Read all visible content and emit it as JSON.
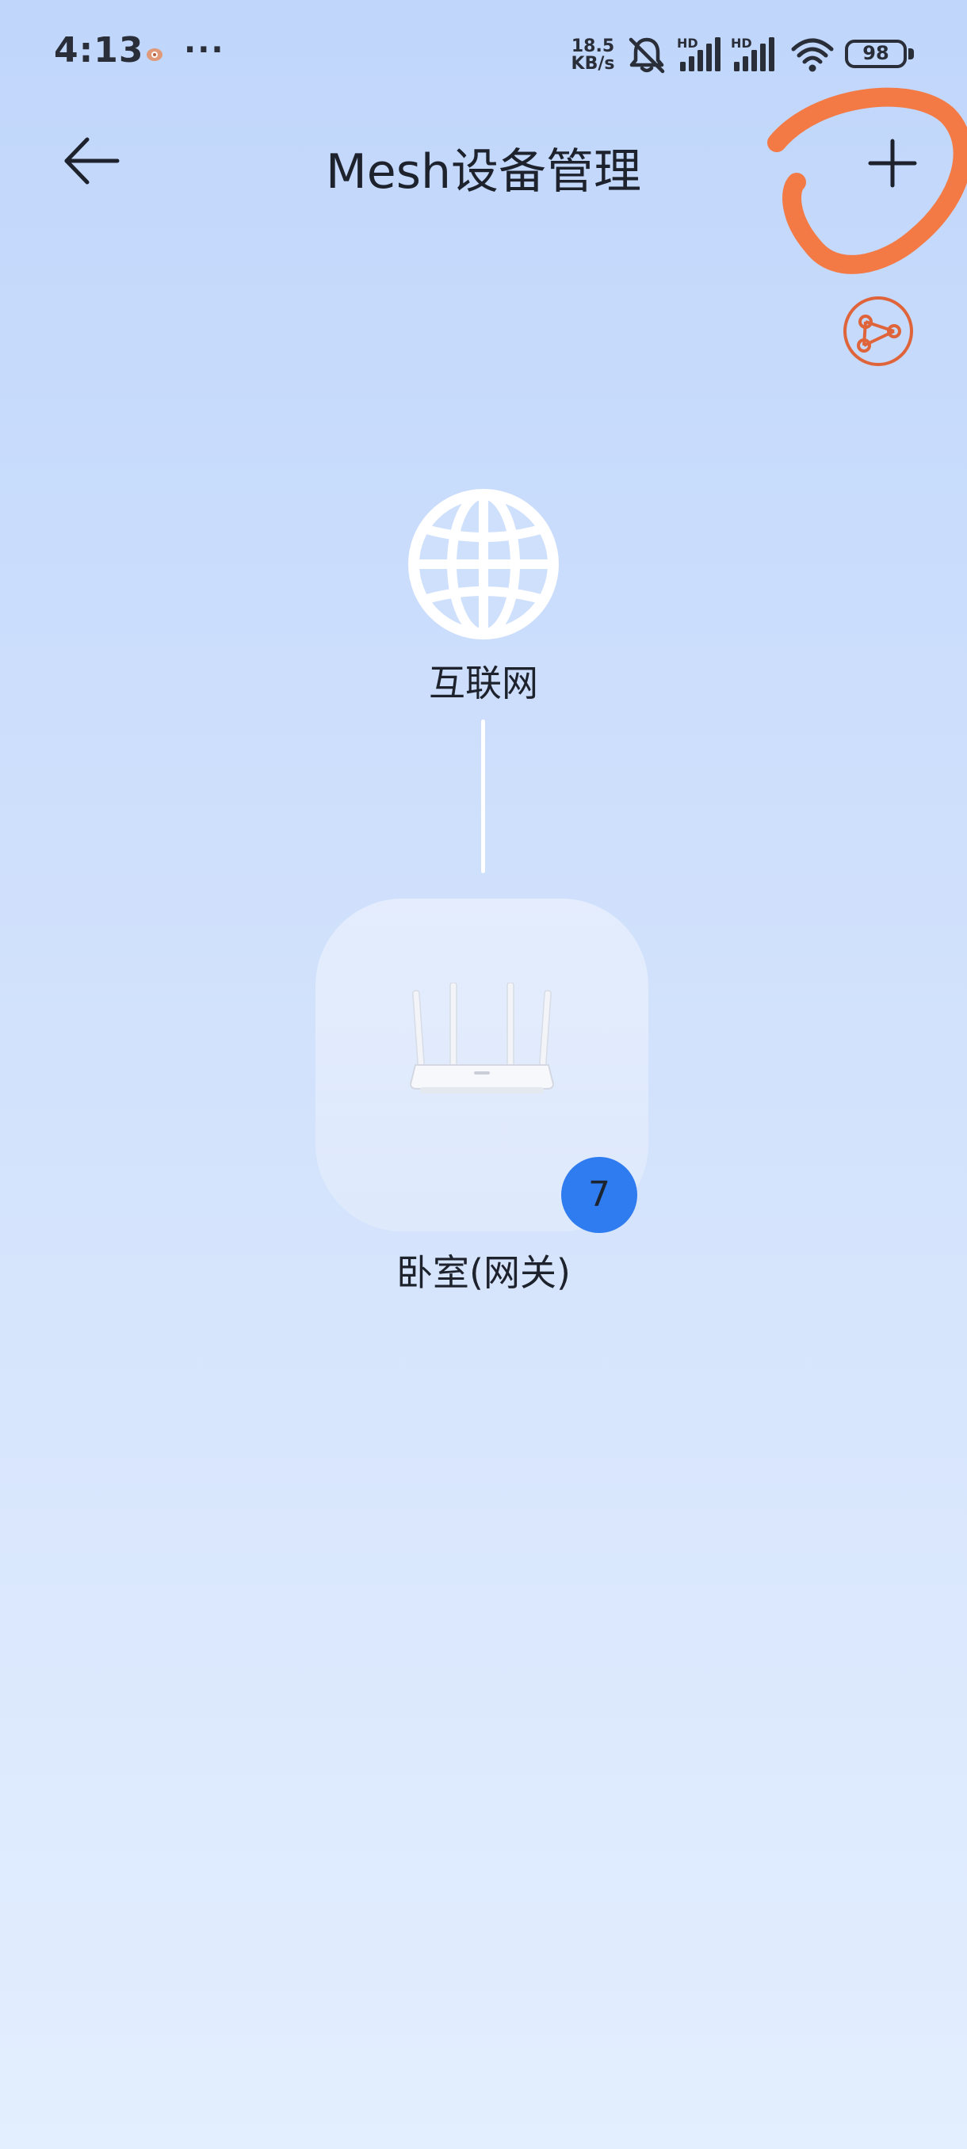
{
  "status_bar": {
    "time": "4:13",
    "more": "···",
    "net_speed_value": "18.5",
    "net_speed_unit": "KB/s",
    "signal_label_1": "HD",
    "signal_label_2": "HD",
    "battery": "98",
    "icons": [
      "app-notification-icon",
      "mute-bell-icon",
      "signal-icon",
      "signal-icon",
      "wifi-icon",
      "battery-icon"
    ]
  },
  "header": {
    "title": "Mesh设备管理",
    "back_icon": "arrow-left-icon",
    "add_icon": "plus-icon",
    "topology_icon": "topology-icon"
  },
  "topology": {
    "internet": {
      "label": "互联网",
      "icon": "globe-icon"
    },
    "router": {
      "label": "卧室(网关)",
      "device_count": "7",
      "icon": "router-icon"
    }
  },
  "colors": {
    "background_top": "#c0d6fb",
    "background_bottom": "#e3eefe",
    "badge": "#2f7cf0",
    "annotation": "#f47a45",
    "topology_icon": "#e0643a"
  }
}
